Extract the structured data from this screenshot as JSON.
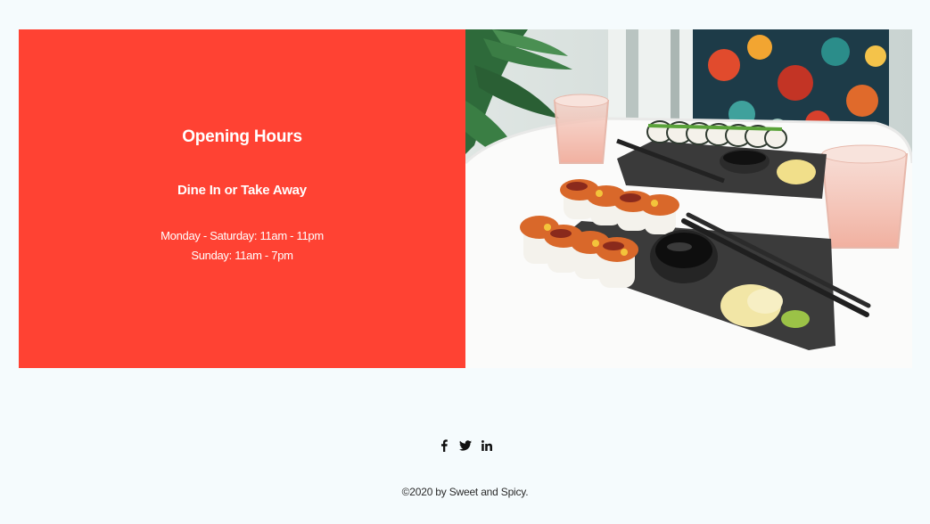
{
  "hours": {
    "title": "Opening Hours",
    "subtitle": "Dine In or Take Away",
    "lines": [
      "Monday - Saturday: 11am - 11pm",
      "Sunday: 11am - 7pm"
    ]
  },
  "photo": {
    "subject": "sushi-plates-image"
  },
  "social": {
    "icons": [
      "facebook-icon",
      "twitter-icon",
      "linkedin-icon"
    ]
  },
  "footer": {
    "copyright": "©2020 by Sweet and Spicy."
  },
  "colors": {
    "page_background": "#f5fbfd",
    "panel_red": "#ff4233",
    "panel_text": "#ffffff"
  }
}
